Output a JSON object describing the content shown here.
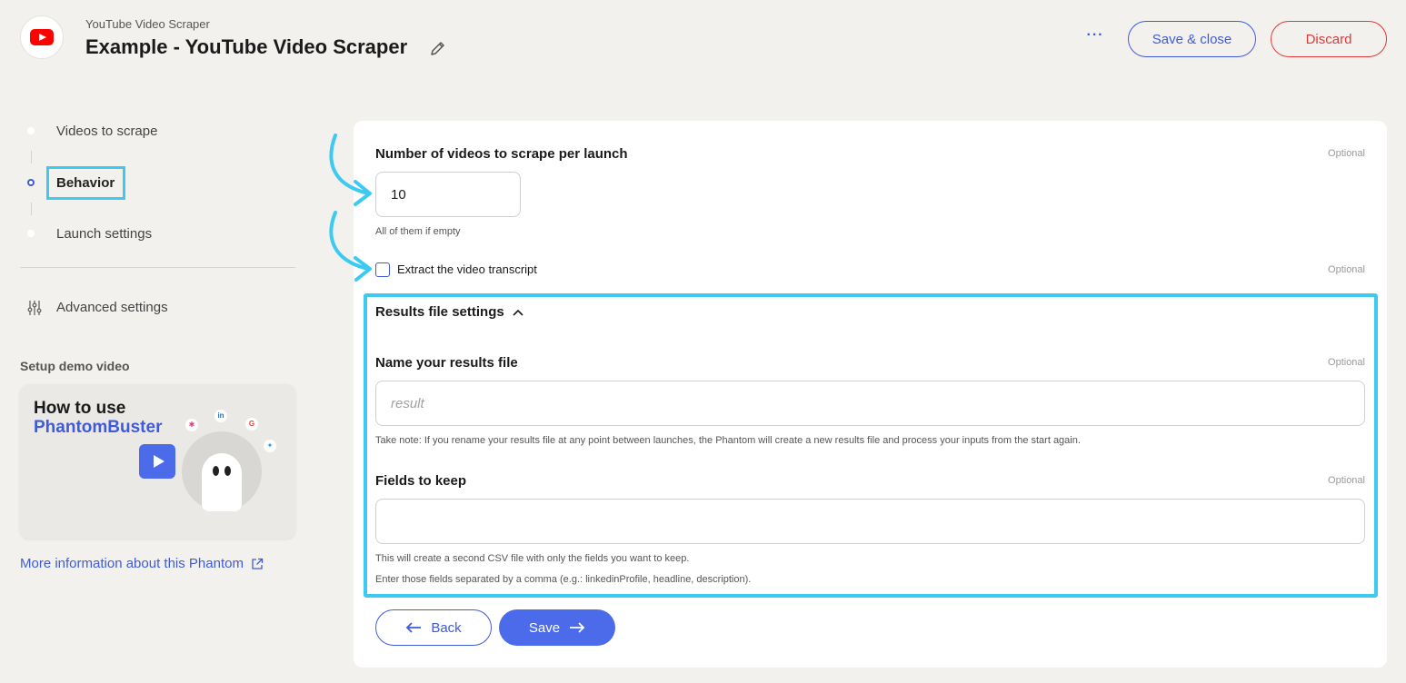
{
  "header": {
    "app_name": "YouTube Video Scraper",
    "title": "Example - YouTube Video Scraper",
    "more_label": "···",
    "save_close_label": "Save & close",
    "discard_label": "Discard"
  },
  "sidebar": {
    "steps": [
      {
        "label": "Videos to scrape",
        "state": "default"
      },
      {
        "label": "Behavior",
        "state": "active"
      },
      {
        "label": "Launch settings",
        "state": "default"
      }
    ],
    "advanced_label": "Advanced settings",
    "demo_heading": "Setup demo video",
    "demo_card": {
      "line1": "How to use",
      "line2": "PhantomBuster"
    },
    "more_info_label": "More information about this Phantom"
  },
  "form": {
    "videos_per_launch": {
      "label": "Number of videos to scrape per launch",
      "value": "10",
      "optional": "Optional",
      "help": "All of them if empty"
    },
    "transcript": {
      "label": "Extract the video transcript",
      "checked": false,
      "optional": "Optional"
    },
    "results_section": {
      "label": "Results file settings",
      "expanded": true
    },
    "results_file_name": {
      "label": "Name your results file",
      "placeholder": "result",
      "value": "",
      "optional": "Optional",
      "help": "Take note: If you rename your results file at any point between launches, the Phantom will create a new results file and process your inputs from the start again."
    },
    "fields_to_keep": {
      "label": "Fields to keep",
      "value": "",
      "optional": "Optional",
      "help1": "This will create a second CSV file with only the fields you want to keep.",
      "help2": "Enter those fields separated by a comma (e.g.: linkedinProfile, headline, description)."
    }
  },
  "footer": {
    "back_label": "Back",
    "save_label": "Save"
  },
  "colors": {
    "accent": "#4b6bea",
    "danger": "#e03a3a",
    "highlight": "#3ccaf0",
    "background": "#f3f1ee"
  }
}
